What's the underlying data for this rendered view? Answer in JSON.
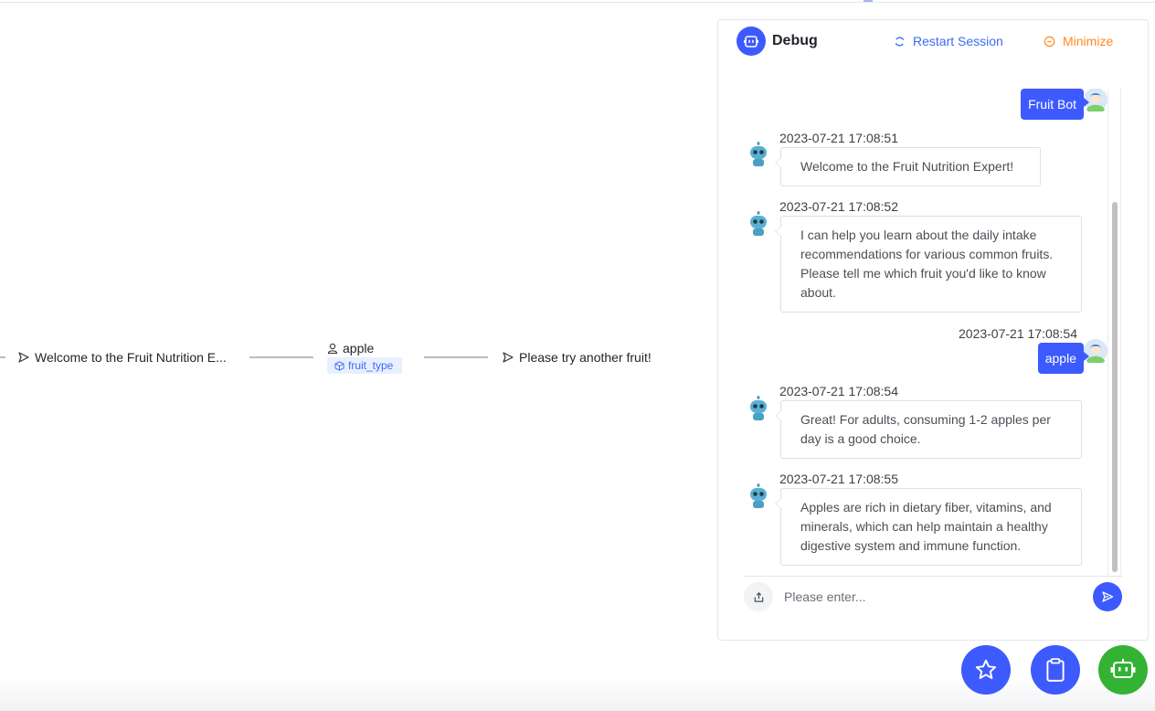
{
  "flow": {
    "node1_text": "Welcome to the Fruit Nutrition E...",
    "user_node_text": "apple",
    "slot_tag": "fruit_type",
    "node3_text": "Please try another fruit!"
  },
  "debug": {
    "title": "Debug",
    "restart_label": "Restart Session",
    "minimize_label": "Minimize",
    "input_placeholder": "Please enter...",
    "messages": [
      {
        "role": "user",
        "text": "Fruit Bot"
      },
      {
        "role": "bot",
        "time": "2023-07-21 17:08:51",
        "text": "Welcome to the Fruit Nutrition Expert!"
      },
      {
        "role": "bot",
        "time": "2023-07-21 17:08:52",
        "text": "I can help you learn about the daily intake recommendations for various common fruits. Please tell me which fruit you'd like to know about."
      },
      {
        "role": "user",
        "time": "2023-07-21 17:08:54",
        "text": "apple"
      },
      {
        "role": "bot",
        "time": "2023-07-21 17:08:54",
        "text": "Great! For adults, consuming 1-2 apples per day is a good choice."
      },
      {
        "role": "bot",
        "time": "2023-07-21 17:08:55",
        "text": "Apples are rich in dietary fiber, vitamins, and minerals, which can help maintain a healthy digestive system and immune function."
      }
    ]
  },
  "colors": {
    "primary": "#3d5afe",
    "warning": "#ff8a1e",
    "success": "#34b233"
  },
  "fabs": [
    "star-icon",
    "clipboard-icon",
    "robot-icon"
  ]
}
